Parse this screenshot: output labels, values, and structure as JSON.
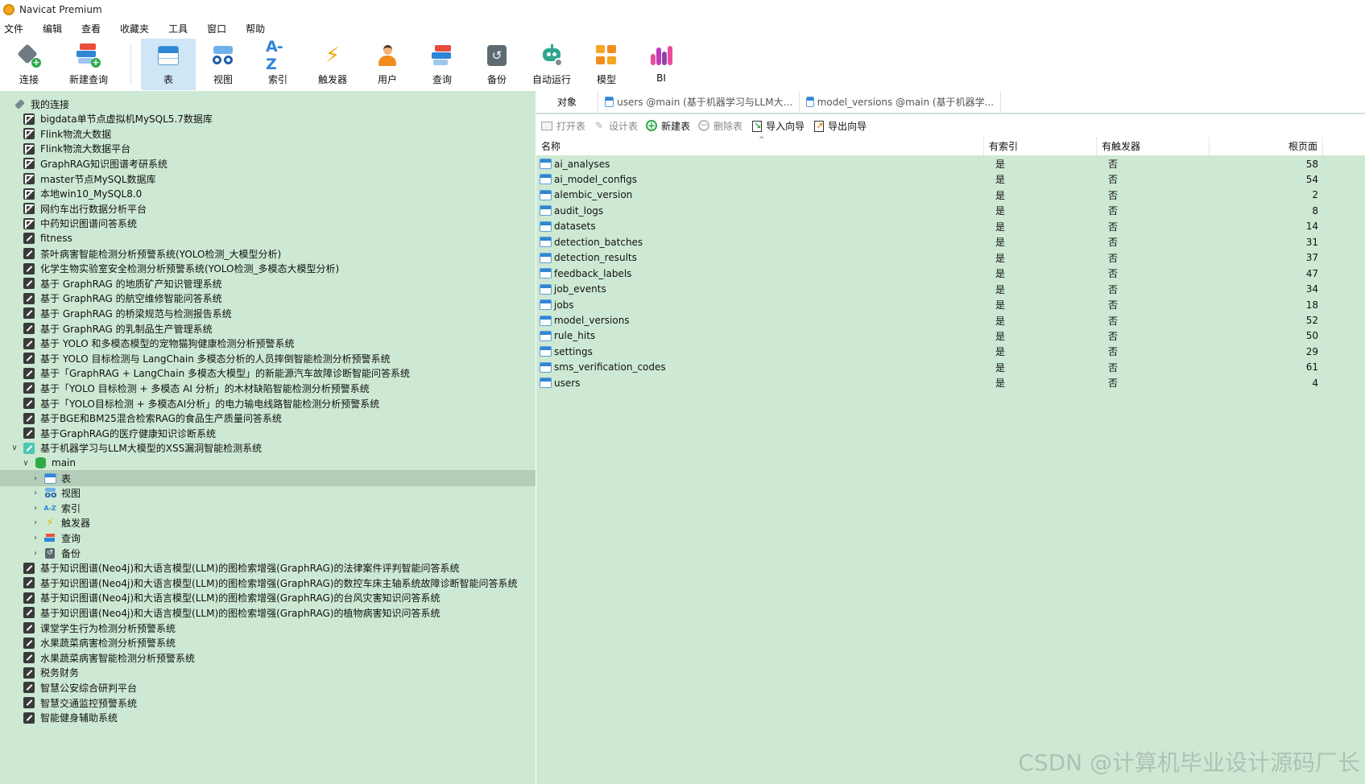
{
  "window": {
    "title": "Navicat Premium"
  },
  "menu": [
    "文件",
    "编辑",
    "查看",
    "收藏夹",
    "工具",
    "窗口",
    "帮助"
  ],
  "toolbar": [
    {
      "label": "连接",
      "icon": "connection-icon"
    },
    {
      "label": "新建查询",
      "icon": "new-query-icon"
    },
    {
      "label": "表",
      "icon": "table-icon",
      "active": true
    },
    {
      "label": "视图",
      "icon": "view-icon"
    },
    {
      "label": "索引",
      "icon": "index-icon"
    },
    {
      "label": "触发器",
      "icon": "trigger-icon"
    },
    {
      "label": "用户",
      "icon": "user-icon"
    },
    {
      "label": "查询",
      "icon": "query-icon"
    },
    {
      "label": "备份",
      "icon": "backup-icon"
    },
    {
      "label": "自动运行",
      "icon": "automation-icon"
    },
    {
      "label": "模型",
      "icon": "model-icon"
    },
    {
      "label": "BI",
      "icon": "bi-icon"
    }
  ],
  "tree": {
    "root_label": "我的连接",
    "connections_before": [
      {
        "label": "bigdata单节点虚拟机MySQL5.7数据库",
        "type": "mysql"
      },
      {
        "label": "Flink物流大数据",
        "type": "mysql"
      },
      {
        "label": "Flink物流大数据平台",
        "type": "mysql"
      },
      {
        "label": "GraphRAG知识图谱考研系统",
        "type": "mysql"
      },
      {
        "label": "master节点MySQL数据库",
        "type": "mysql"
      },
      {
        "label": "本地win10_MySQL8.0",
        "type": "mysql"
      },
      {
        "label": "网约车出行数据分析平台",
        "type": "mysql"
      },
      {
        "label": "中药知识图谱问答系统",
        "type": "mysql"
      },
      {
        "label": "fitness",
        "type": "generic"
      },
      {
        "label": "茶叶病害智能检测分析预警系统(YOLO检测_大模型分析)",
        "type": "generic"
      },
      {
        "label": "化学生物实验室安全检测分析预警系统(YOLO检测_多模态大模型分析)",
        "type": "generic"
      },
      {
        "label": "基于 GraphRAG 的地质矿产知识管理系统",
        "type": "generic"
      },
      {
        "label": "基于 GraphRAG 的航空维修智能问答系统",
        "type": "generic"
      },
      {
        "label": "基于 GraphRAG 的桥梁规范与检测报告系统",
        "type": "generic"
      },
      {
        "label": "基于 GraphRAG 的乳制品生产管理系统",
        "type": "generic"
      },
      {
        "label": "基于 YOLO 和多模态模型的宠物猫狗健康检测分析预警系统",
        "type": "generic"
      },
      {
        "label": "基于 YOLO 目标检测与 LangChain 多模态分析的人员摔倒智能检测分析预警系统",
        "type": "generic"
      },
      {
        "label": "基于「GraphRAG + LangChain 多模态大模型」的新能源汽车故障诊断智能问答系统",
        "type": "generic"
      },
      {
        "label": "基于「YOLO 目标检测 + 多模态 AI 分析」的木材缺陷智能检测分析预警系统",
        "type": "generic"
      },
      {
        "label": "基于「YOLO目标检测 + 多模态AI分析」的电力输电线路智能检测分析预警系统",
        "type": "generic"
      },
      {
        "label": "基于BGE和BM25混合检索RAG的食品生产质量问答系统",
        "type": "generic"
      },
      {
        "label": "基于GraphRAG的医疗健康知识诊断系统",
        "type": "generic"
      }
    ],
    "open_connection": {
      "label": "基于机器学习与LLM大模型的XSS漏洞智能检测系统",
      "database": "main",
      "children": [
        {
          "label": "表",
          "icon": "table-icon",
          "selected": true
        },
        {
          "label": "视图",
          "icon": "view-icon"
        },
        {
          "label": "索引",
          "icon": "index-icon"
        },
        {
          "label": "触发器",
          "icon": "trigger-icon"
        },
        {
          "label": "查询",
          "icon": "query-icon"
        },
        {
          "label": "备份",
          "icon": "backup-icon"
        }
      ]
    },
    "connections_after": [
      {
        "label": "基于知识图谱(Neo4j)和大语言模型(LLM)的图检索增强(GraphRAG)的法律案件评判智能问答系统"
      },
      {
        "label": "基于知识图谱(Neo4j)和大语言模型(LLM)的图检索增强(GraphRAG)的数控车床主轴系统故障诊断智能问答系统"
      },
      {
        "label": "基于知识图谱(Neo4j)和大语言模型(LLM)的图检索增强(GraphRAG)的台风灾害知识问答系统"
      },
      {
        "label": "基于知识图谱(Neo4j)和大语言模型(LLM)的图检索增强(GraphRAG)的植物病害知识问答系统"
      },
      {
        "label": "课堂学生行为检测分析预警系统"
      },
      {
        "label": "水果蔬菜病害检测分析预警系统"
      },
      {
        "label": "水果蔬菜病害智能检测分析预警系统"
      },
      {
        "label": "税务财务"
      },
      {
        "label": "智慧公安综合研判平台"
      },
      {
        "label": "智慧交通监控预警系统"
      },
      {
        "label": "智能健身辅助系统"
      }
    ]
  },
  "tabs": [
    {
      "label": "对象",
      "active": true
    },
    {
      "label": "users @main (基于机器学习与LLM大..."
    },
    {
      "label": "model_versions @main (基于机器学..."
    }
  ],
  "object_toolbar": {
    "open": "打开表",
    "design": "设计表",
    "new": "新建表",
    "delete": "删除表",
    "import": "导入向导",
    "export": "导出向导"
  },
  "grid": {
    "columns": {
      "name": "名称",
      "has_index": "有索引",
      "has_trigger": "有触发器",
      "root_pages": "根页面"
    },
    "rows": [
      {
        "name": "ai_analyses",
        "has_index": "是",
        "has_trigger": "否",
        "root_pages": "58"
      },
      {
        "name": "ai_model_configs",
        "has_index": "是",
        "has_trigger": "否",
        "root_pages": "54"
      },
      {
        "name": "alembic_version",
        "has_index": "是",
        "has_trigger": "否",
        "root_pages": "2"
      },
      {
        "name": "audit_logs",
        "has_index": "是",
        "has_trigger": "否",
        "root_pages": "8"
      },
      {
        "name": "datasets",
        "has_index": "是",
        "has_trigger": "否",
        "root_pages": "14"
      },
      {
        "name": "detection_batches",
        "has_index": "是",
        "has_trigger": "否",
        "root_pages": "31"
      },
      {
        "name": "detection_results",
        "has_index": "是",
        "has_trigger": "否",
        "root_pages": "37"
      },
      {
        "name": "feedback_labels",
        "has_index": "是",
        "has_trigger": "否",
        "root_pages": "47"
      },
      {
        "name": "job_events",
        "has_index": "是",
        "has_trigger": "否",
        "root_pages": "34"
      },
      {
        "name": "jobs",
        "has_index": "是",
        "has_trigger": "否",
        "root_pages": "18"
      },
      {
        "name": "model_versions",
        "has_index": "是",
        "has_trigger": "否",
        "root_pages": "52"
      },
      {
        "name": "rule_hits",
        "has_index": "是",
        "has_trigger": "否",
        "root_pages": "50"
      },
      {
        "name": "settings",
        "has_index": "是",
        "has_trigger": "否",
        "root_pages": "29"
      },
      {
        "name": "sms_verification_codes",
        "has_index": "是",
        "has_trigger": "否",
        "root_pages": "61"
      },
      {
        "name": "users",
        "has_index": "是",
        "has_trigger": "否",
        "root_pages": "4"
      }
    ]
  },
  "watermark": "CSDN @计算机毕业设计源码厂长",
  "colors": {
    "panel_bg": "#cde9d3",
    "selected_row": "#b3cdb9",
    "accent": "#2f86d6"
  }
}
